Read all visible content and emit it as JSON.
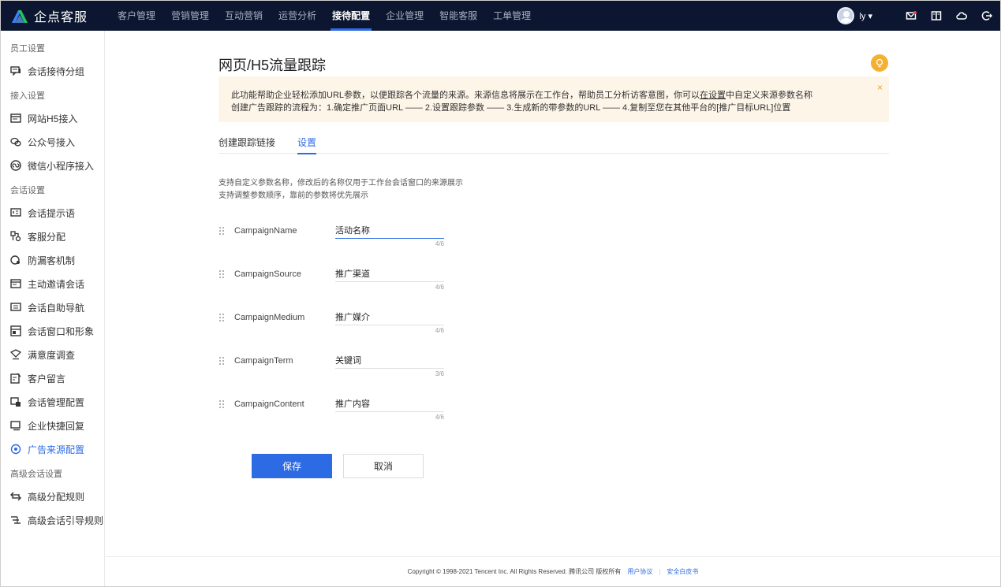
{
  "app": {
    "name": "企点客服"
  },
  "nav": {
    "items": [
      {
        "label": "客户管理"
      },
      {
        "label": "营销管理"
      },
      {
        "label": "互动营销"
      },
      {
        "label": "运营分析"
      },
      {
        "label": "接待配置",
        "active": true
      },
      {
        "label": "企业管理"
      },
      {
        "label": "智能客服"
      },
      {
        "label": "工单管理"
      }
    ]
  },
  "user": {
    "name": "ly"
  },
  "sidebar": {
    "groups": [
      {
        "title": "员工设置",
        "items": [
          {
            "label": "会话接待分组",
            "icon": "chat-group-icon"
          }
        ]
      },
      {
        "title": "接入设置",
        "items": [
          {
            "label": "网站H5接入",
            "icon": "web-icon"
          },
          {
            "label": "公众号接入",
            "icon": "wechat-icon"
          },
          {
            "label": "微信小程序接入",
            "icon": "mini-program-icon"
          }
        ]
      },
      {
        "title": "会话设置",
        "items": [
          {
            "label": "会话提示语",
            "icon": "prompt-icon"
          },
          {
            "label": "客服分配",
            "icon": "assign-icon"
          },
          {
            "label": "防漏客机制",
            "icon": "guard-icon"
          },
          {
            "label": "主动邀请会话",
            "icon": "invite-icon"
          },
          {
            "label": "会话自助导航",
            "icon": "nav-icon"
          },
          {
            "label": "会话窗口和形象",
            "icon": "window-icon"
          },
          {
            "label": "满意度调查",
            "icon": "survey-icon"
          },
          {
            "label": "客户留言",
            "icon": "message-icon"
          },
          {
            "label": "会话管理配置",
            "icon": "manage-icon"
          },
          {
            "label": "企业快捷回复",
            "icon": "quick-reply-icon"
          },
          {
            "label": "广告来源配置",
            "icon": "target-icon",
            "active": true
          }
        ]
      },
      {
        "title": "高级会话设置",
        "items": [
          {
            "label": "高级分配规则",
            "icon": "swap-icon"
          },
          {
            "label": "高级会话引导规则",
            "icon": "guide-icon"
          }
        ]
      }
    ]
  },
  "page": {
    "title": "网页/H5流量跟踪",
    "notice": {
      "line1_a": "此功能帮助企业轻松添加URL参数，以便跟踪各个流量的来源。来源信息将展示在工作台，帮助员工分析访客意图，你可以",
      "line1_link": "在设置",
      "line1_b": "中自定义来源参数名称",
      "line2": "创建广告跟踪的流程为：1.确定推广页面URL —— 2.设置跟踪参数 —— 3.生成新的带参数的URL —— 4.复制至您在其他平台的[推广目标URL]位置",
      "close": "×"
    },
    "tabs": [
      {
        "label": "创建跟踪链接"
      },
      {
        "label": "设置",
        "active": true
      }
    ],
    "desc_line1": "支持自定义参数名称，修改后的名称仅用于工作台会话窗口的来源展示",
    "desc_line2": "支持调整参数顺序，靠前的参数将优先展示",
    "params": [
      {
        "name": "CampaignName",
        "value": "活动名称",
        "count": "4/6"
      },
      {
        "name": "CampaignSource",
        "value": "推广渠道",
        "count": "4/6"
      },
      {
        "name": "CampaignMedium",
        "value": "推广媒介",
        "count": "4/6"
      },
      {
        "name": "CampaignTerm",
        "value": "关键词",
        "count": "3/6"
      },
      {
        "name": "CampaignContent",
        "value": "推广内容",
        "count": "4/6"
      }
    ],
    "save": "保存",
    "cancel": "取消"
  },
  "footer": {
    "copyright": "Copyright © 1998-2021 Tencent Inc. All Rights Reserved. 腾讯公司 版权所有",
    "link1": "用户协议",
    "sep": "|",
    "link2": "安全白皮书"
  },
  "colors": {
    "accent": "#2d6be4",
    "topbar": "#0c1631",
    "notice_bg": "#fdf5e8",
    "bulb": "#f5b031"
  }
}
